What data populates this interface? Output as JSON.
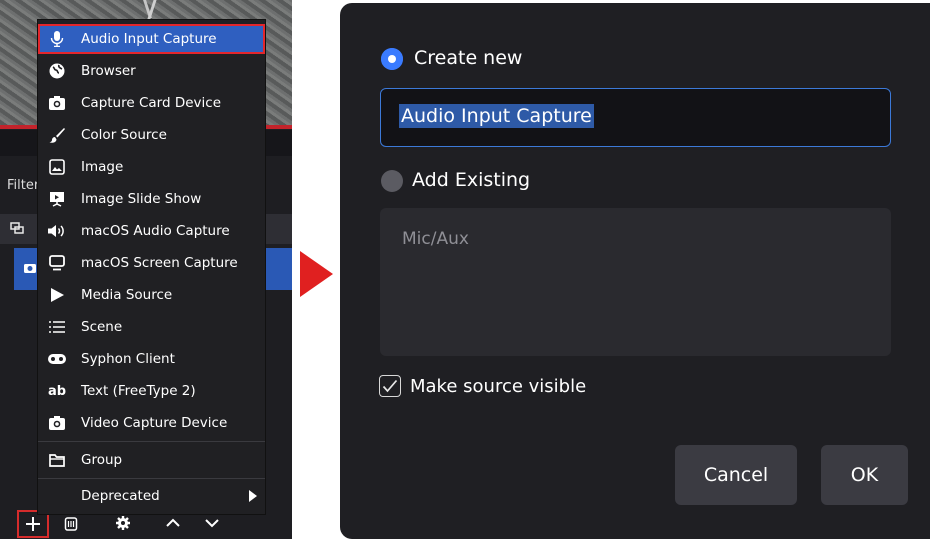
{
  "left_panel": {
    "filter_label": "Filter",
    "toolbar": {
      "add_icon": "plus-icon",
      "trash_icon": "trash-icon",
      "gear_icon": "gear-icon",
      "up_icon": "chevron-up-icon",
      "down_icon": "chevron-down-icon"
    },
    "accent_color": "#2a59b5",
    "highlight_outline_color": "#e3262c"
  },
  "menu": {
    "items": [
      {
        "label": "Audio Input Capture",
        "icon": "microphone-icon"
      },
      {
        "label": "Browser",
        "icon": "globe-icon"
      },
      {
        "label": "Capture Card Device",
        "icon": "camera-icon"
      },
      {
        "label": "Color Source",
        "icon": "brush-icon"
      },
      {
        "label": "Image",
        "icon": "image-icon"
      },
      {
        "label": "Image Slide Show",
        "icon": "slideshow-icon"
      },
      {
        "label": "macOS Audio Capture",
        "icon": "speaker-icon"
      },
      {
        "label": "macOS Screen Capture",
        "icon": "monitor-icon"
      },
      {
        "label": "Media Source",
        "icon": "play-icon"
      },
      {
        "label": "Scene",
        "icon": "list-icon"
      },
      {
        "label": "Syphon Client",
        "icon": "syphon-icon"
      },
      {
        "label": "Text (FreeType 2)",
        "icon": "text-icon"
      },
      {
        "label": "Video Capture Device",
        "icon": "camera-icon"
      }
    ],
    "group": {
      "label": "Group",
      "icon": "folder-icon"
    },
    "deprecated": {
      "label": "Deprecated",
      "icon": "submenu-arrow-icon"
    }
  },
  "dialog": {
    "create_new_label": "Create new",
    "name_value": "Audio Input Capture",
    "add_existing_label": "Add Existing",
    "existing_items": [
      "Mic/Aux"
    ],
    "make_visible_label": "Make source visible",
    "make_visible_checked": true,
    "cancel_label": "Cancel",
    "ok_label": "OK",
    "radio_color": "#3a7bff"
  }
}
